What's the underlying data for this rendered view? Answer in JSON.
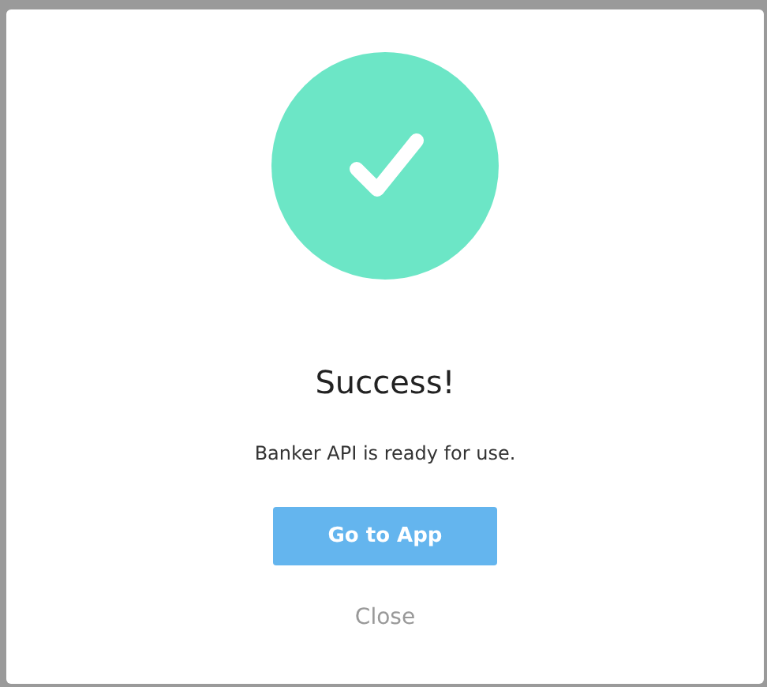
{
  "dialog": {
    "title": "Success!",
    "message": "Banker API is ready for use.",
    "primary_button": "Go to App",
    "close_link": "Close"
  }
}
